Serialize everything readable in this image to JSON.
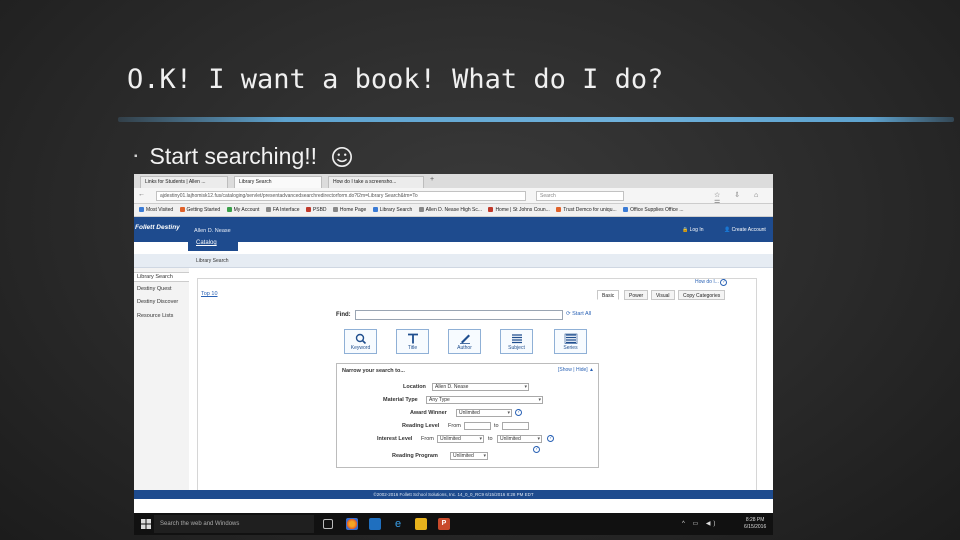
{
  "slide": {
    "title": "O.K! I want a book! What do I do?",
    "bullet": "Start searching!!",
    "bullet_marker": "▪",
    "emoji": "smiley-icon"
  },
  "browser": {
    "tabs": [
      {
        "label": "Links for Students | Allen ..."
      },
      {
        "label": "Library Search"
      },
      {
        "label": "How do I take a screensho..."
      }
    ],
    "url": "ajdestiny01.lajhomisk12.fus/cataloging/servlet/presentadvancedsearchredirectorform.do?l2m=Library Search&tm=To",
    "search_placeholder": "Search",
    "bookmarks": [
      "Most Visited",
      "Getting Started",
      "My Account",
      "FA Interface",
      "PSBD",
      "Home Page",
      "Library Search",
      "Allen D. Nease High Sc...",
      "Home | St Johns Coun...",
      "Trust Demco for uniqu...",
      "Office Supplies Office ..."
    ]
  },
  "app": {
    "logo": "Follett Destiny",
    "school": "Allen D. Nease",
    "login": "Log In",
    "create_account": "Create Account",
    "catalog_tab": "Catalog",
    "subnav": "Library Search",
    "sidebar": [
      "Library Search",
      "Destiny Quest",
      "Destiny Discover",
      "Resource Lists"
    ],
    "how_do_i": "How do I...",
    "top_link": "Top 10",
    "search_tabs": [
      "Basic",
      "Power",
      "Visual",
      "Copy Categories"
    ],
    "find_label": "Find:",
    "start_all": "Start All",
    "search_buttons": [
      "Keyword",
      "Title",
      "Author",
      "Subject",
      "Series"
    ],
    "narrow": {
      "title": "Narrow your search to...",
      "show_hide": "[Show | Hide]",
      "location_label": "Location",
      "location_value": "Allen D. Nease",
      "material_label": "Material Type",
      "material_value": "Any Type",
      "award_label": "Award Winner",
      "award_value": "Unlimited",
      "reading_level_label": "Reading Level",
      "from": "From",
      "to": "to",
      "interest_label": "Interest Level",
      "interest_from": "Unlimited",
      "interest_to": "Unlimited",
      "program_label": "Reading Program",
      "program_value": "Unlimited"
    },
    "footer": "©2002-2016 Follett School Solutions, Inc.    14_0_0_RC9    6/15/2016 8:28 PM EDT"
  },
  "taskbar": {
    "search_placeholder": "Search the web and Windows",
    "time": "8:28 PM",
    "date": "6/15/2016"
  },
  "colors": {
    "title_rule": "#5ea3cf",
    "destiny_blue": "#1e4b8e",
    "link_blue": "#2a62b5"
  }
}
